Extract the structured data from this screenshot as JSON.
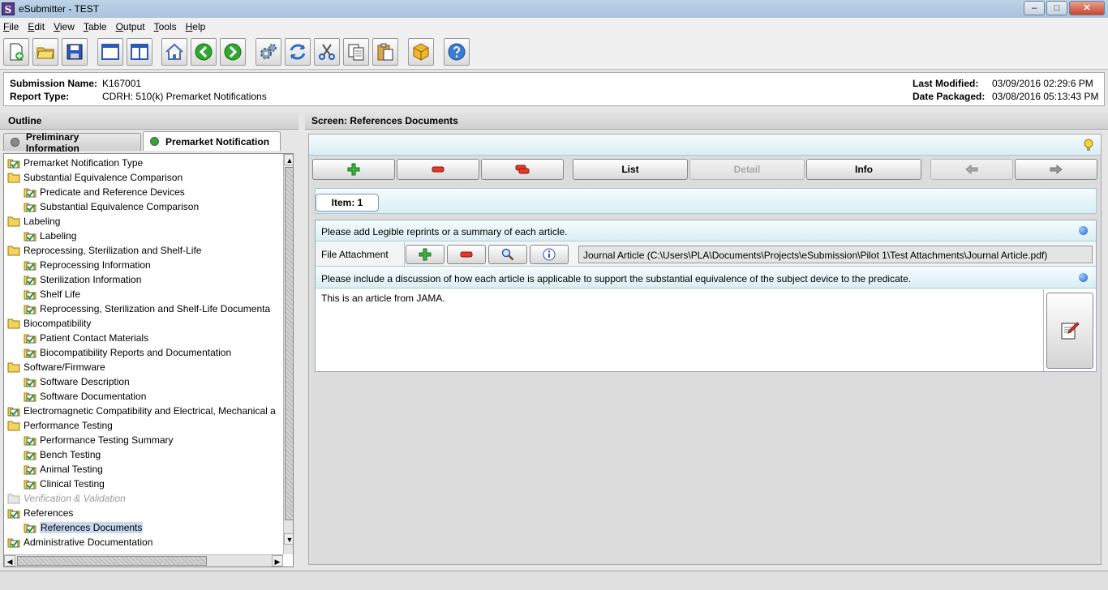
{
  "window": {
    "title": "eSubmitter - TEST",
    "app_icon_letter": "S",
    "controls": {
      "minimize": "–",
      "maximize": "□",
      "close": "✕"
    }
  },
  "menu": [
    "File",
    "Edit",
    "View",
    "Table",
    "Output",
    "Tools",
    "Help"
  ],
  "toolbar": [
    {
      "name": "new-document-icon"
    },
    {
      "name": "open-folder-icon"
    },
    {
      "name": "save-disk-icon"
    },
    {
      "name": "single-pane-icon"
    },
    {
      "name": "split-pane-icon"
    },
    {
      "name": "home-icon"
    },
    {
      "name": "back-arrow-icon"
    },
    {
      "name": "forward-arrow-icon"
    },
    {
      "name": "gears-icon"
    },
    {
      "name": "refresh-icon"
    },
    {
      "name": "cut-scissors-icon"
    },
    {
      "name": "copy-icon"
    },
    {
      "name": "paste-clipboard-icon"
    },
    {
      "name": "package-box-icon"
    },
    {
      "name": "help-icon"
    }
  ],
  "info": {
    "submission_name_label": "Submission Name:",
    "submission_name": "K167001",
    "report_type_label": "Report Type:",
    "report_type": "CDRH: 510(k) Premarket Notifications",
    "last_modified_label": "Last Modified:",
    "last_modified": "03/09/2016 02:29:6 PM",
    "date_packaged_label": "Date Packaged:",
    "date_packaged": "03/08/2016 05:13:43 PM"
  },
  "outline": {
    "header": "Outline",
    "tabs": [
      {
        "label": "Preliminary Information",
        "status_color": "#8a8a8a",
        "active": false
      },
      {
        "label": "Premarket Notification",
        "status_color": "#2fa82f",
        "active": true
      }
    ],
    "tree": [
      {
        "label": "Premarket Notification Type",
        "level": 0,
        "icon": "check"
      },
      {
        "label": "Substantial Equivalence Comparison",
        "level": 0,
        "icon": "folder"
      },
      {
        "label": "Predicate and Reference Devices",
        "level": 1,
        "icon": "check"
      },
      {
        "label": "Substantial Equivalence Comparison",
        "level": 1,
        "icon": "check"
      },
      {
        "label": "Labeling",
        "level": 0,
        "icon": "folder"
      },
      {
        "label": "Labeling",
        "level": 1,
        "icon": "check"
      },
      {
        "label": "Reprocessing, Sterilization and Shelf-Life",
        "level": 0,
        "icon": "folder"
      },
      {
        "label": "Reprocessing Information",
        "level": 1,
        "icon": "check"
      },
      {
        "label": "Sterilization Information",
        "level": 1,
        "icon": "check"
      },
      {
        "label": "Shelf Life",
        "level": 1,
        "icon": "check"
      },
      {
        "label": "Reprocessing, Sterilization and Shelf-Life Documenta",
        "level": 1,
        "icon": "check"
      },
      {
        "label": "Biocompatibility",
        "level": 0,
        "icon": "folder"
      },
      {
        "label": "Patient Contact Materials",
        "level": 1,
        "icon": "check"
      },
      {
        "label": "Biocompatibility Reports and Documentation",
        "level": 1,
        "icon": "check"
      },
      {
        "label": "Software/Firmware",
        "level": 0,
        "icon": "folder"
      },
      {
        "label": "Software Description",
        "level": 1,
        "icon": "check"
      },
      {
        "label": "Software Documentation",
        "level": 1,
        "icon": "check"
      },
      {
        "label": "Electromagnetic Compatibility and Electrical, Mechanical a",
        "level": 0,
        "icon": "check"
      },
      {
        "label": "Performance Testing",
        "level": 0,
        "icon": "folder"
      },
      {
        "label": "Performance Testing Summary",
        "level": 1,
        "icon": "check"
      },
      {
        "label": "Bench Testing",
        "level": 1,
        "icon": "check"
      },
      {
        "label": "Animal Testing",
        "level": 1,
        "icon": "check"
      },
      {
        "label": "Clinical Testing",
        "level": 1,
        "icon": "check"
      },
      {
        "label": "Verification & Validation",
        "level": 0,
        "icon": "folder-disabled",
        "disabled": true
      },
      {
        "label": "References",
        "level": 0,
        "icon": "check"
      },
      {
        "label": "References Documents",
        "level": 1,
        "icon": "check",
        "selected": true
      },
      {
        "label": "Administrative Documentation",
        "level": 0,
        "icon": "check"
      }
    ]
  },
  "screen": {
    "header": "Screen: References Documents",
    "nav": {
      "list": "List",
      "detail": "Detail",
      "info": "Info"
    },
    "item_tab": "Item: 1",
    "prompt1": "Please add Legible reprints or a summary of each article.",
    "file_attachment_label": "File Attachment",
    "file_attachment_path": "Journal Article (C:\\Users\\PLA\\Documents\\Projects\\eSubmission\\Pilot 1\\Test Attachments\\Journal Article.pdf)",
    "prompt2": "Please include a discussion of how each article is applicable to support the substantial equivalence of the subject device to the predicate.",
    "text_value": "This is an article from JAMA."
  }
}
